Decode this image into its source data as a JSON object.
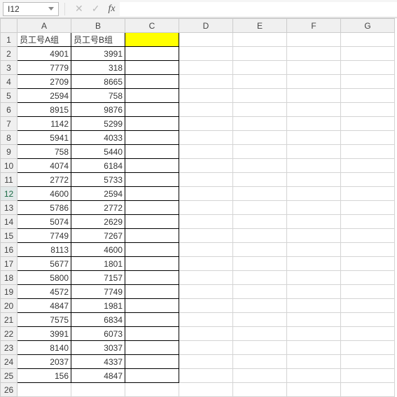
{
  "formula_bar": {
    "name_box": "I12",
    "cancel": "✕",
    "confirm": "✓",
    "fx": "fx",
    "formula": ""
  },
  "columns": [
    "A",
    "B",
    "C",
    "D",
    "E",
    "F",
    "G"
  ],
  "row_count": 26,
  "selected_row": 12,
  "headers": {
    "A": "员工号A组",
    "B": "员工号B组"
  },
  "highlight_cell": "C1",
  "data": {
    "A": [
      4901,
      7779,
      2709,
      2594,
      8915,
      1142,
      5941,
      758,
      4074,
      2772,
      4600,
      5786,
      5074,
      7749,
      8113,
      5677,
      5800,
      4572,
      4847,
      7575,
      3991,
      8140,
      2037,
      156
    ],
    "B": [
      3991,
      318,
      8665,
      758,
      9876,
      5299,
      4033,
      5440,
      6184,
      5733,
      2594,
      2772,
      2629,
      7267,
      4600,
      1801,
      7157,
      7749,
      1981,
      6834,
      6073,
      3037,
      4337,
      4847
    ]
  },
  "chart_data": {
    "type": "table",
    "title": "",
    "columns": [
      "员工号A组",
      "员工号B组"
    ],
    "rows": [
      [
        4901,
        3991
      ],
      [
        7779,
        318
      ],
      [
        2709,
        8665
      ],
      [
        2594,
        758
      ],
      [
        8915,
        9876
      ],
      [
        1142,
        5299
      ],
      [
        5941,
        4033
      ],
      [
        758,
        5440
      ],
      [
        4074,
        6184
      ],
      [
        2772,
        5733
      ],
      [
        4600,
        2594
      ],
      [
        5786,
        2772
      ],
      [
        5074,
        2629
      ],
      [
        7749,
        7267
      ],
      [
        8113,
        4600
      ],
      [
        5677,
        1801
      ],
      [
        5800,
        7157
      ],
      [
        4572,
        7749
      ],
      [
        4847,
        1981
      ],
      [
        7575,
        6834
      ],
      [
        3991,
        6073
      ],
      [
        8140,
        3037
      ],
      [
        2037,
        4337
      ],
      [
        156,
        4847
      ]
    ]
  }
}
